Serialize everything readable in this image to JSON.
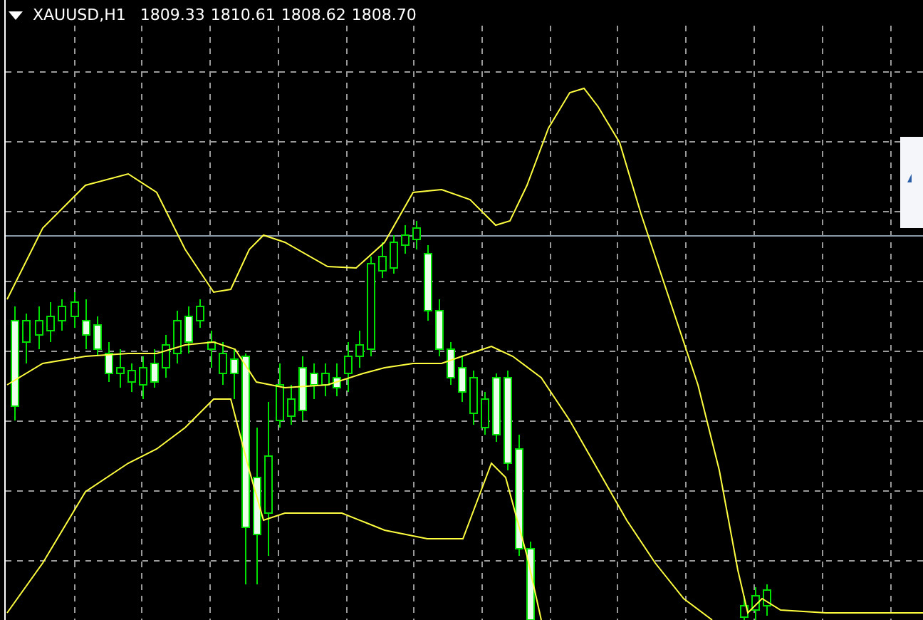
{
  "chart": {
    "symbol": "XAUUSD,H1",
    "quotes": [
      "1809.33",
      "1810.61",
      "1808.62",
      "1808.70"
    ]
  }
}
